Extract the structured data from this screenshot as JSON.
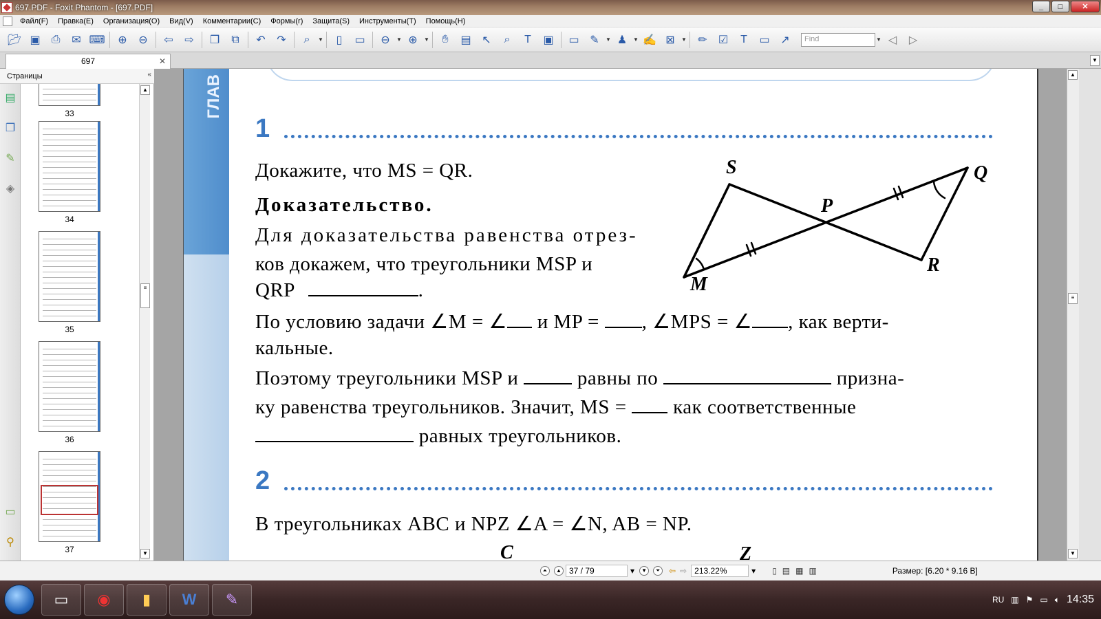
{
  "window": {
    "title": "697.PDF - Foxit Phantom - [697.PDF]",
    "min": "_",
    "max": "□",
    "close": "✕"
  },
  "menu": [
    "Файл(F)",
    "Правка(E)",
    "Организация(O)",
    "Вид(V)",
    "Комментарии(C)",
    "Формы(r)",
    "Защита(S)",
    "Инструменты(T)",
    "Помощь(H)"
  ],
  "toolbar": {
    "icons": [
      "open-icon",
      "save-icon",
      "print-icon",
      "email-icon",
      "scan-icon",
      "|",
      "nav-up-icon",
      "nav-down-icon",
      "|",
      "back-icon",
      "forward-icon",
      "|",
      "page-layout-icon",
      "page-extract-icon",
      "|",
      "undo-icon",
      "redo-icon",
      "|",
      "zoom-icon",
      "|",
      "fit-page-icon",
      "fit-width-icon",
      "|",
      "zoom-out-icon",
      "zoom-in-icon",
      "|",
      "hand-icon",
      "snapshot-icon",
      "select-icon",
      "find-icon",
      "text-select-icon",
      "image-icon",
      "|",
      "rectangle-icon",
      "edit-icon",
      "stamp-icon",
      "sign-icon",
      "lock-icon",
      "|",
      "pencil-icon",
      "form-icon",
      "textbox-icon",
      "note-icon",
      "arrow-icon"
    ],
    "find_placeholder": "Find"
  },
  "tab": {
    "label": "697",
    "close": "✕"
  },
  "left_panel": {
    "title": "Страницы",
    "collapse": "«",
    "pages": [
      "33",
      "34",
      "35",
      "36",
      "37"
    ]
  },
  "document": {
    "side_text": "ГЛАВ",
    "task1_num": "1",
    "line1": "Докажите, что MS = QR.",
    "proof_title": "Доказательство.",
    "line3": "Для доказательства равенства отрез-",
    "line4": "ков докажем, что треугольники MSP и",
    "line5": "QRP",
    "line6a": "По условию задачи ∠M = ∠",
    "line6b": " и MP = ",
    "line6c": ", ∠MPS = ∠",
    "line6d": ", как верти-",
    "line7": "кальные.",
    "line8a": "Поэтому треугольники MSP и ",
    "line8b": " равны по ",
    "line8c": " призна-",
    "line9a": "ку равенства треугольников. Значит, MS = ",
    "line9b": " как соответственные",
    "line10": " равных треугольников.",
    "task2_num": "2",
    "line11": "В треугольниках ABC и NPZ ∠A = ∠N, AB = NP.",
    "figure_labels": {
      "S": "S",
      "Q": "Q",
      "P": "P",
      "M": "M",
      "R": "R"
    },
    "bottom_labels": {
      "C": "C",
      "Z": "Z"
    }
  },
  "status": {
    "page": "37 / 79",
    "zoom": "213.22%",
    "size": "Размер: [6.20 * 9.16 В]"
  },
  "taskbar": {
    "lang": "RU",
    "time": "14:35"
  }
}
